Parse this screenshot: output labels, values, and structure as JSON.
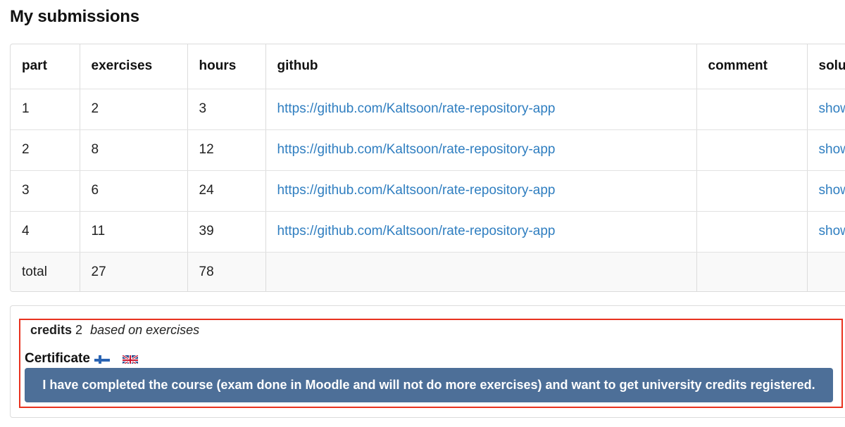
{
  "page": {
    "title": "My submissions"
  },
  "table": {
    "columns": [
      "part",
      "exercises",
      "hours",
      "github",
      "comment",
      "solut"
    ],
    "rows": [
      {
        "part": "1",
        "exercises": "2",
        "hours": "3",
        "github": "https://github.com/Kaltsoon/rate-repository-app",
        "comment": "",
        "solutions": "show"
      },
      {
        "part": "2",
        "exercises": "8",
        "hours": "12",
        "github": "https://github.com/Kaltsoon/rate-repository-app",
        "comment": "",
        "solutions": "show"
      },
      {
        "part": "3",
        "exercises": "6",
        "hours": "24",
        "github": "https://github.com/Kaltsoon/rate-repository-app",
        "comment": "",
        "solutions": "show"
      },
      {
        "part": "4",
        "exercises": "11",
        "hours": "39",
        "github": "https://github.com/Kaltsoon/rate-repository-app",
        "comment": "",
        "solutions": "show"
      }
    ],
    "total": {
      "label": "total",
      "exercises": "27",
      "hours": "78"
    }
  },
  "credits": {
    "label": "credits",
    "value": "2",
    "basis": "based on exercises"
  },
  "certificate": {
    "label": "Certificate",
    "flags": [
      "finland-flag-icon",
      "uk-flag-icon"
    ]
  },
  "complete_button": {
    "label": "I have completed the course (exam done in Moodle and will not do more exercises) and want to get university credits registered."
  },
  "colors": {
    "link": "#2f7ec0",
    "button": "#4d6f98",
    "highlight": "#e8321f"
  }
}
